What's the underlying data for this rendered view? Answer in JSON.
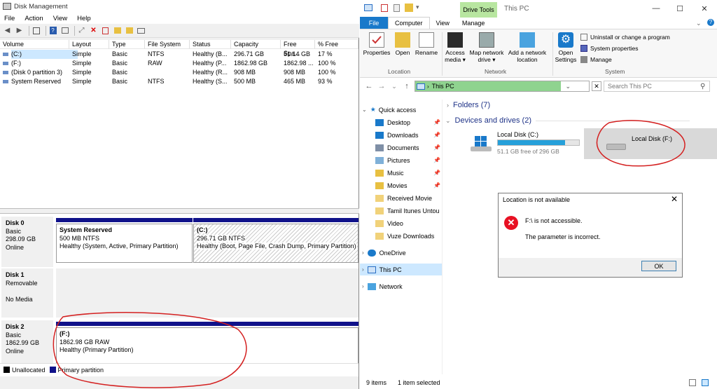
{
  "dm": {
    "title": "Disk Management",
    "menu": [
      "File",
      "Action",
      "View",
      "Help"
    ],
    "columns": [
      "Volume",
      "Layout",
      "Type",
      "File System",
      "Status",
      "Capacity",
      "Free Spa...",
      "% Free"
    ],
    "rows": [
      [
        "(C:)",
        "Simple",
        "Basic",
        "NTFS",
        "Healthy (B...",
        "296.71 GB",
        "51.14 GB",
        "17 %"
      ],
      [
        "(F:)",
        "Simple",
        "Basic",
        "RAW",
        "Healthy (P...",
        "1862.98 GB",
        "1862.98 ...",
        "100 %"
      ],
      [
        "(Disk 0 partition 3)",
        "Simple",
        "Basic",
        "",
        "Healthy (R...",
        "908 MB",
        "908 MB",
        "100 %"
      ],
      [
        "System Reserved",
        "Simple",
        "Basic",
        "NTFS",
        "Healthy (S...",
        "500 MB",
        "465 MB",
        "93 %"
      ]
    ],
    "disks": {
      "d0": {
        "name": "Disk 0",
        "l1": "Basic",
        "l2": "298.09 GB",
        "l3": "Online"
      },
      "d1": {
        "name": "Disk 1",
        "l1": "Removable",
        "l3": "No Media"
      },
      "d2": {
        "name": "Disk 2",
        "l1": "Basic",
        "l2": "1862.99 GB",
        "l3": "Online"
      }
    },
    "parts": {
      "sysres": {
        "name": "System Reserved",
        "size": "500 MB NTFS",
        "status": "Healthy (System, Active, Primary Partition)"
      },
      "c": {
        "name": "(C:)",
        "size": "296.71 GB NTFS",
        "status": "Healthy (Boot, Page File, Crash Dump, Primary Partition)"
      },
      "f": {
        "name": "(F:)",
        "size": "1862.98 GB RAW",
        "status": "Healthy (Primary Partition)"
      }
    },
    "legend": {
      "unallocated": "Unallocated",
      "primary": "Primary partition"
    }
  },
  "ex": {
    "drive_tools": "Drive Tools",
    "title": "This PC",
    "tabs": {
      "file": "File",
      "computer": "Computer",
      "view": "View",
      "manage": "Manage"
    },
    "ribbon": {
      "properties": "Properties",
      "open": "Open",
      "rename": "Rename",
      "access_media": "Access media ▾",
      "map_network": "Map network drive ▾",
      "add_location": "Add a network location",
      "open_settings": "Open Settings",
      "uninstall": "Uninstall or change a program",
      "system_properties": "System properties",
      "manage": "Manage",
      "grp_location": "Location",
      "grp_network": "Network",
      "grp_system": "System"
    },
    "address": "This PC",
    "search_placeholder": "Search This PC",
    "nav": {
      "quick_access": "Quick access",
      "items": [
        "Desktop",
        "Downloads",
        "Documents",
        "Pictures",
        "Music",
        "Movies",
        "Received Movie",
        "Tamil Itunes Untou",
        "Video",
        "Vuze Downloads"
      ],
      "onedrive": "OneDrive",
      "this_pc": "This PC",
      "network": "Network"
    },
    "folders": "Folders (7)",
    "devices": "Devices and drives (2)",
    "drive_c": {
      "name": "Local Disk (C:)",
      "free": "51.1 GB free of 296 GB",
      "used_fraction": 0.83
    },
    "drive_f": {
      "name": "Local Disk (F:)"
    },
    "status_items": "9 items",
    "status_selected": "1 item selected",
    "colors": {
      "accent": "#1979ca",
      "drive_tools_tab": "#b8e6a0",
      "error": "#e81123",
      "address_fill": "#8fd38f"
    }
  },
  "dialog": {
    "title": "Location is not available",
    "msg1": "F:\\ is not accessible.",
    "msg2": "The parameter is incorrect.",
    "ok": "OK"
  }
}
